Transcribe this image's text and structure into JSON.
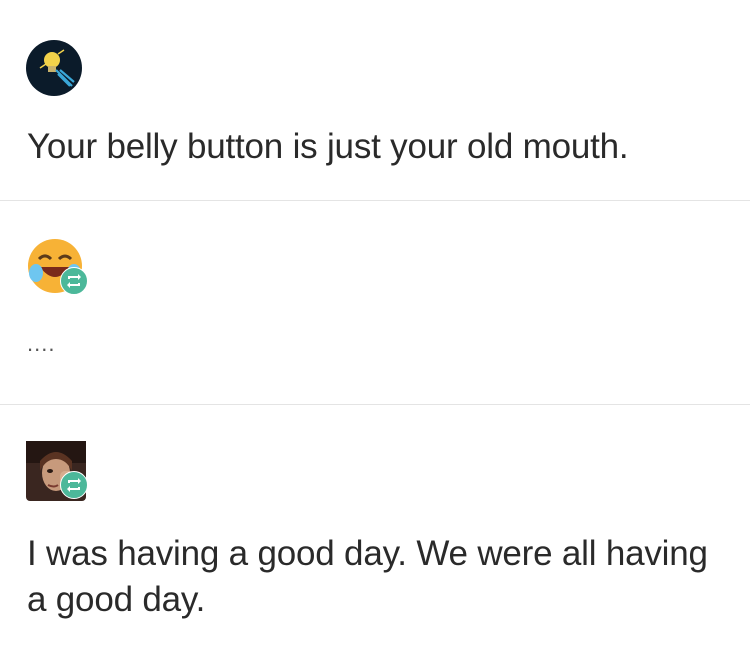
{
  "posts": [
    {
      "avatar_icon": "lightbulb-avatar-icon",
      "reblogged": false,
      "text": "Your belly button is just your old mouth."
    },
    {
      "avatar_icon": "laughing-emoji-avatar-icon",
      "reblogged": true,
      "text": "...."
    },
    {
      "avatar_icon": "person-photo-avatar-icon",
      "reblogged": true,
      "text": "I was having a good day. We were all having a good day."
    }
  ],
  "colors": {
    "reblog_badge": "#4cb89a",
    "divider": "#e4e4e4",
    "text": "#2a2a2a"
  }
}
